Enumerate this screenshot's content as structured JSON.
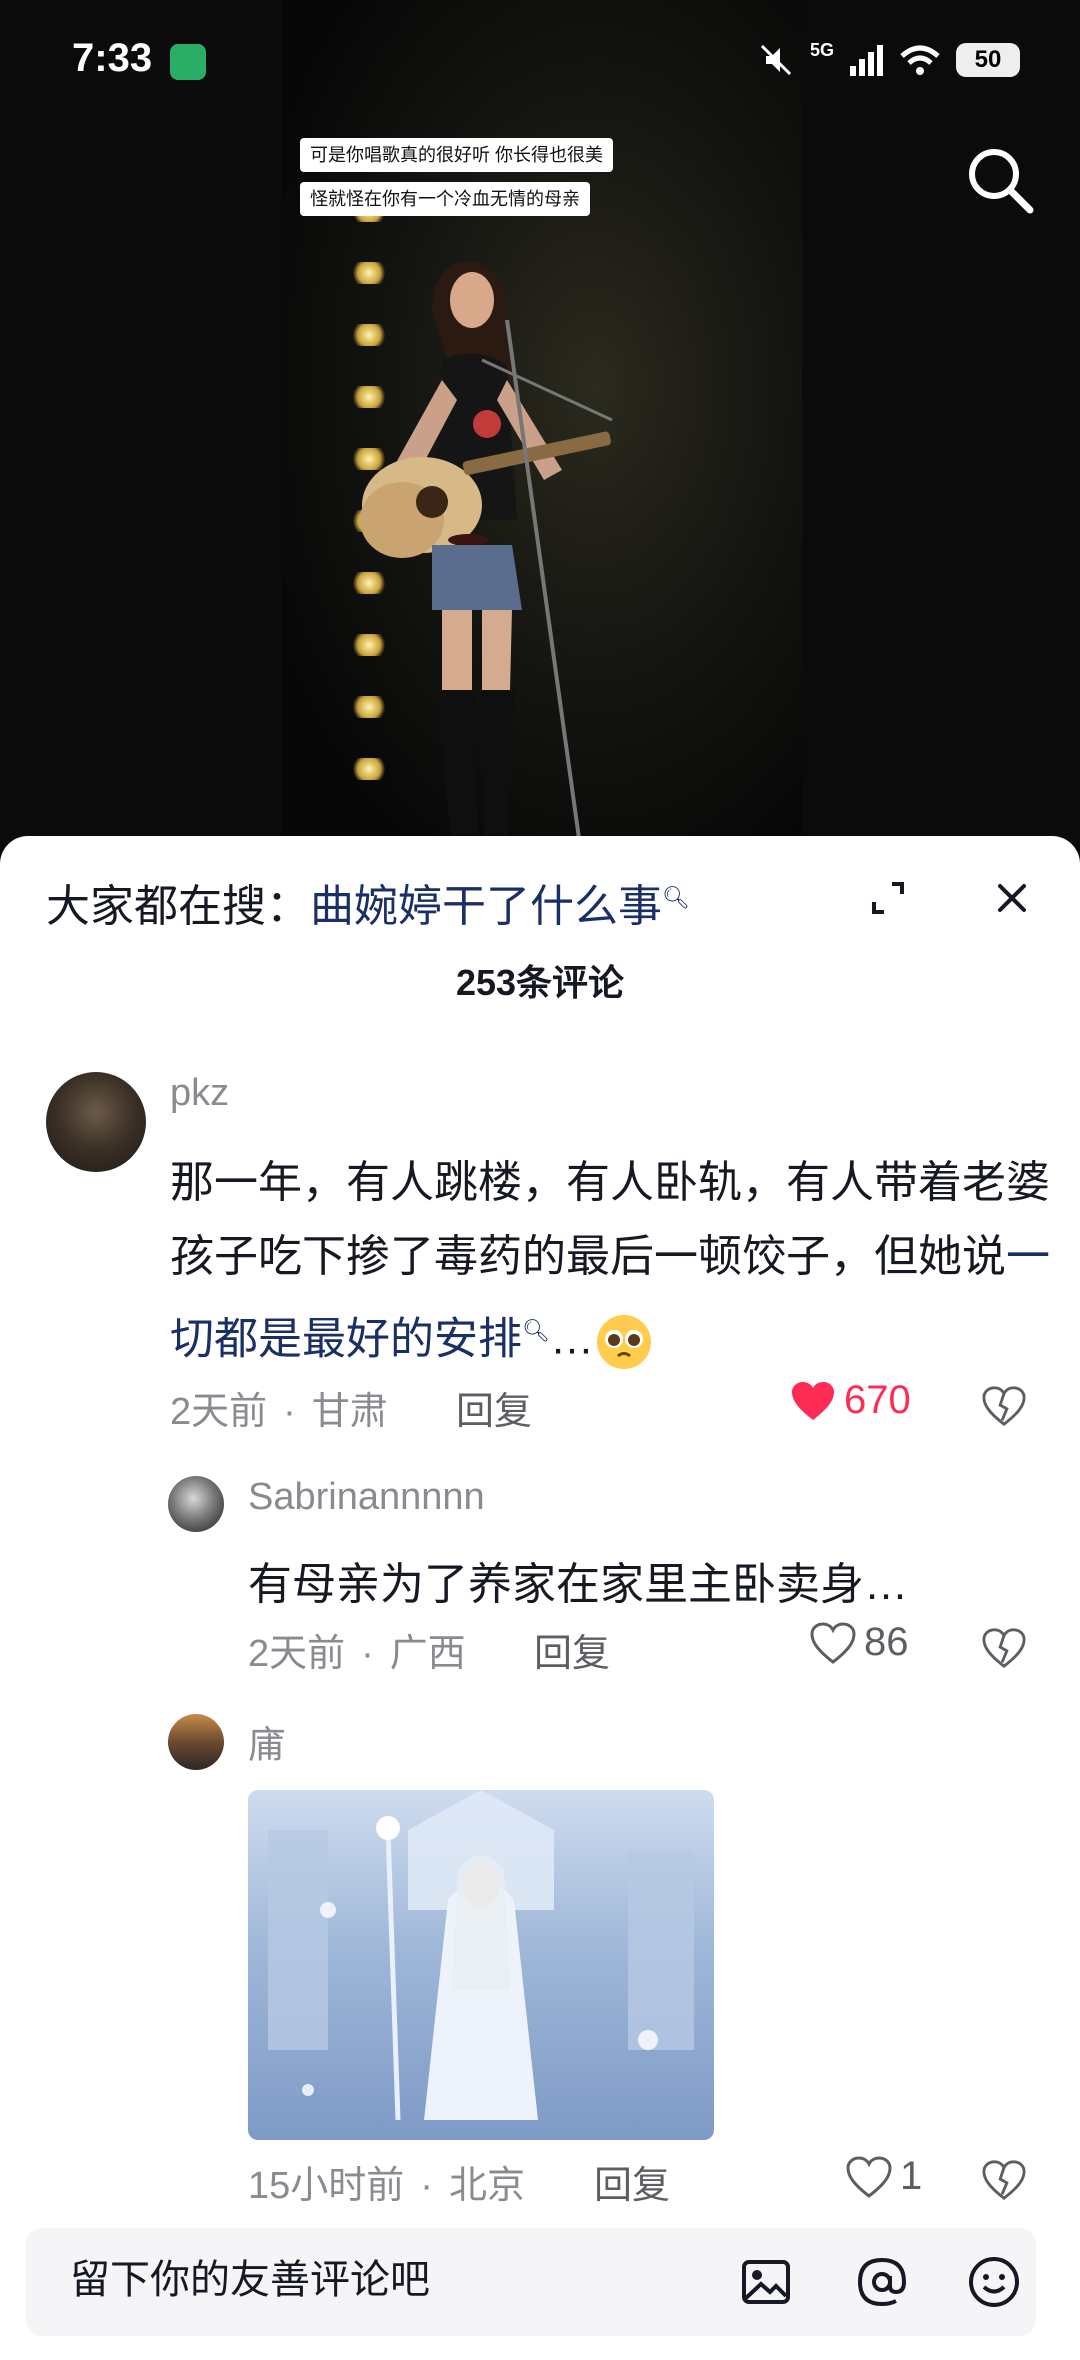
{
  "status_bar": {
    "time": "7:33",
    "network": "5G",
    "battery": "50"
  },
  "video": {
    "captions": [
      "可是你唱歌真的很好听 你长得也很美",
      "怪就怪在你有一个冷血无情的母亲"
    ]
  },
  "sheet": {
    "hot_search_prefix": "大家都在搜：",
    "hot_search_keyword": "曲婉婷干了什么事",
    "comment_count": "253条评论"
  },
  "comments": [
    {
      "username": "pkz",
      "text_before": "那一年，有人跳楼，有人卧轨，有人带着老婆孩子吃下掺了毒药的最后一顿饺子，但她说",
      "text_link": "一切都是最好的安排",
      "text_after": "…",
      "time": "2天前",
      "location": "甘肃",
      "reply_label": "回复",
      "likes": "670",
      "liked": true
    },
    {
      "username": "Sabrinannnnn",
      "text": "有母亲为了养家在家里主卧卖身…",
      "time": "2天前",
      "location": "广西",
      "reply_label": "回复",
      "likes": "86"
    },
    {
      "username": "庯",
      "time": "15小时前",
      "location": "北京",
      "reply_label": "回复",
      "likes": "1"
    }
  ],
  "input": {
    "placeholder": "留下你的友善评论吧"
  },
  "colors": {
    "accent_link": "#1a2f66",
    "like_red": "#fe2c55",
    "meta_gray": "#8a8b91"
  }
}
